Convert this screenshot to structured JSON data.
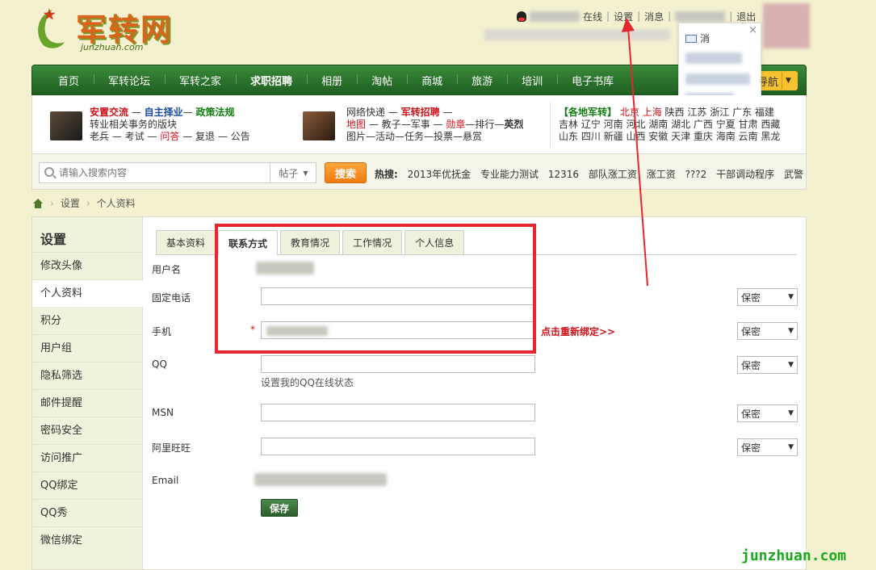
{
  "header": {
    "logo_text": "军转网",
    "logo_url": "junzhuan.com",
    "topbar": {
      "online": "在线",
      "settings": "设置",
      "messages": "消息",
      "logout": "退出"
    },
    "popup": {
      "message_label": "消"
    }
  },
  "nav": {
    "items": [
      "首页",
      "军转论坛",
      "军转之家",
      "求职招聘",
      "相册",
      "淘帖",
      "商城",
      "旅游",
      "培训",
      "电子书库"
    ],
    "dropdown_label": "导航"
  },
  "quick": {
    "block1": {
      "line1": [
        "安置交流",
        "—",
        "自主择业",
        "—",
        "政策法规"
      ],
      "line2": "转业相关事务的版块",
      "line3": [
        "老兵",
        "—",
        "考试",
        "—",
        "问答",
        "—",
        "复退",
        "—",
        "公告"
      ]
    },
    "block2": {
      "line1": [
        "网络快递",
        "—",
        "军转招聘",
        "—"
      ],
      "line2": [
        "地图",
        "—",
        "教子",
        "—",
        "军事",
        "—",
        "勋章",
        "—",
        "排行",
        "—",
        "英烈"
      ],
      "line3": "图片—活动—任务—投票—悬赏"
    },
    "block3": {
      "title": "【各地军转】",
      "line1": [
        "北京",
        "上海",
        "陕西",
        "江苏",
        "浙江",
        "广东",
        "福建"
      ],
      "line2": "吉林 辽宁 河南 河北 湖南 湖北 广西 宁夏 甘肃 西藏",
      "line3": "山东 四川 新疆 山西 安徽 天津 重庆 海南 云南 黑龙"
    }
  },
  "search": {
    "placeholder": "请输入搜索内容",
    "type_selected": "帖子",
    "button": "搜索",
    "hot_label": "热搜:",
    "hot_terms": [
      "2013年优抚金",
      "专业能力测试",
      "12316",
      "部队涨工资",
      "涨工资",
      "???2",
      "干部调动程序",
      "武警"
    ]
  },
  "breadcrumb": {
    "items": [
      "设置",
      "个人资料"
    ]
  },
  "sidebar": {
    "title": "设置",
    "items": [
      "修改头像",
      "个人资料",
      "积分",
      "用户组",
      "隐私筛选",
      "邮件提醒",
      "密码安全",
      "访问推广",
      "QQ绑定",
      "QQ秀",
      "微信绑定"
    ],
    "active_index": 1
  },
  "tabs": [
    "基本资料",
    "联系方式",
    "教育情况",
    "工作情况",
    "个人信息"
  ],
  "active_tab": 1,
  "form": {
    "username_label": "用户名",
    "phone_label": "固定电话",
    "mobile_label": "手机",
    "mobile_required": "*",
    "rebind_link": "点击重新绑定>>",
    "qq_label": "QQ",
    "qq_hint": "设置我的QQ在线状态",
    "msn_label": "MSN",
    "wangwang_label": "阿里旺旺",
    "email_label": "Email",
    "privacy_option": "保密",
    "save_button": "保存"
  },
  "watermark": "junzhuan.com",
  "colors": {
    "nav_green": "#2a6e2b",
    "accent_orange": "#f08a1c",
    "annotation_red": "#e8262f",
    "page_bg": "#f3f1cf"
  }
}
